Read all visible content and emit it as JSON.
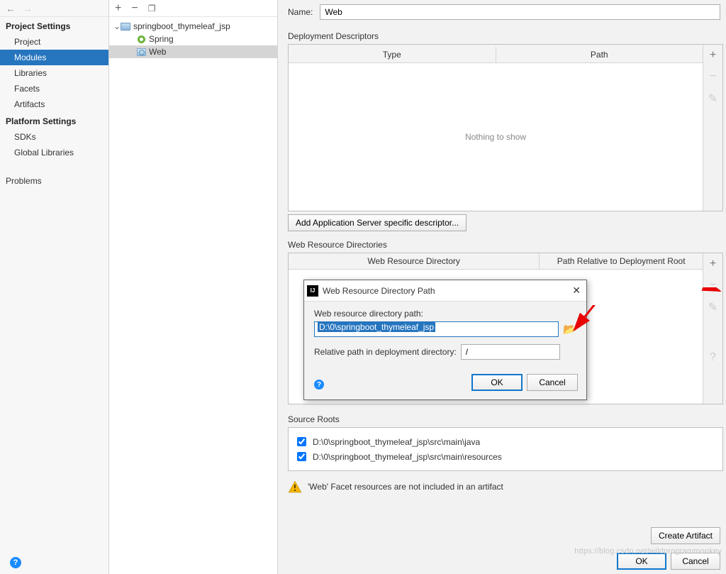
{
  "sidebar": {
    "project_settings": "Project Settings",
    "items_ps": [
      "Project",
      "Modules",
      "Libraries",
      "Facets",
      "Artifacts"
    ],
    "selected_ps_index": 1,
    "platform_settings": "Platform Settings",
    "items_pl": [
      "SDKs",
      "Global Libraries"
    ],
    "problems": "Problems"
  },
  "tree": {
    "project_name": "springboot_thymeleaf_jsp",
    "children": [
      "Spring",
      "Web"
    ],
    "selected_child_index": 1
  },
  "top": {
    "name_label": "Name:",
    "name_value": "Web"
  },
  "desc": {
    "group_label": "Deployment Descriptors",
    "col_type": "Type",
    "col_path": "Path",
    "empty": "Nothing to show",
    "add_btn": "Add Application Server specific descriptor..."
  },
  "webres": {
    "group_label": "Web Resource Directories",
    "col_a": "Web Resource Directory",
    "col_b": "Path Relative to Deployment Root"
  },
  "sourceroots": {
    "group_label": "Source Roots",
    "rows": [
      "D:\\0\\springboot_thymeleaf_jsp\\src\\main\\java",
      "D:\\0\\springboot_thymeleaf_jsp\\src\\main\\resources"
    ]
  },
  "warning": {
    "text": "'Web' Facet resources are not included in an artifact",
    "create_btn": "Create Artifact"
  },
  "footer": {
    "ok": "OK",
    "cancel": "Cancel"
  },
  "modal": {
    "title": "Web Resource Directory Path",
    "label_path": "Web resource directory path:",
    "value_path": "D:\\0\\springboot_thymeleaf_jsp",
    "label_relative": "Relative path in deployment directory:",
    "value_relative": "/",
    "ok": "OK",
    "cancel": "Cancel"
  },
  "watermark": "https://blog.csdn.net/wildprogrammonkey"
}
